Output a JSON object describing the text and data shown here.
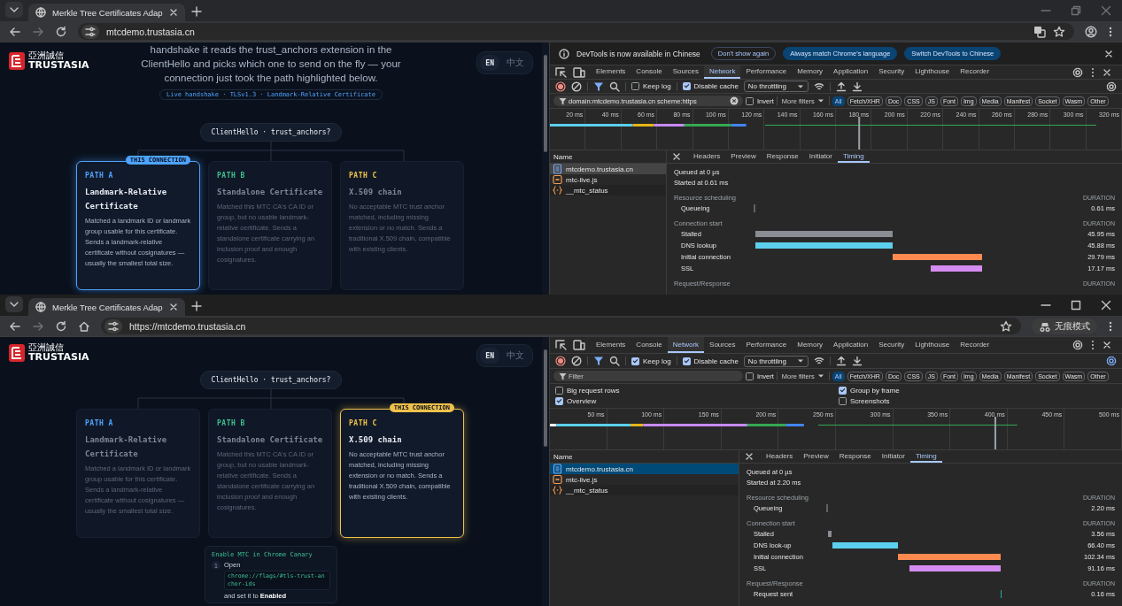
{
  "windows": [
    {
      "active": false,
      "tab_title": "Merkle Tree Certificates Adap",
      "address": "mtcdemo.trustasia.cn",
      "home_button": false,
      "translate_button": true,
      "profile_button": true,
      "page": {
        "logo": {
          "cn": "亞洲誠信",
          "en": "TRUSTASIA"
        },
        "languages": [
          {
            "label": "EN",
            "selected": true
          },
          {
            "label": "中文",
            "selected": false
          }
        ],
        "intro": "handshake it reads the trust_anchors extension in the ClientHello and picks which one to send on the fly — your connection just took the path highlighted below.",
        "handshake_badge": "Live handshake · TLSv1.3 · Landmark-Relative Certificate",
        "root": "ClientHello · trust_anchors?",
        "selected_badge": "THIS CONNECTION",
        "paths": [
          {
            "label": "PATH A",
            "title": "Landmark-Relative Certificate",
            "text": "Matched a landmark ID or landmark group usable for this certificate. Sends a landmark-relative certificate without cosignatures — usually the smallest total size.",
            "color": "#4ea3ff",
            "selected": true
          },
          {
            "label": "PATH B",
            "title": "Standalone Certificate",
            "text": "Matched this MTC CA's CA ID or group, but no usable landmark-relative certificate. Sends a standalone certificate carrying an inclusion proof and enough cosignatures.",
            "color": "#3fbf8f",
            "selected": false
          },
          {
            "label": "PATH C",
            "title": "X.509 chain",
            "text": "No acceptable MTC trust anchor matched, including missing extension or no match. Sends a traditional X.509 chain, compatible with existing clients.",
            "color": "#f0c24b",
            "selected": false
          }
        ]
      },
      "devtools": {
        "infobar": {
          "text": "DevTools is now available in Chinese",
          "buttons": [
            {
              "label": "Don't show again",
              "kind": "outline"
            },
            {
              "label": "Always match Chrome's language",
              "kind": "filled"
            },
            {
              "label": "Switch DevTools to Chinese",
              "kind": "filled"
            }
          ]
        },
        "panels": [
          {
            "label": "Elements",
            "selected": false
          },
          {
            "label": "Console",
            "selected": false
          },
          {
            "label": "Sources",
            "selected": false
          },
          {
            "label": "Network",
            "selected": true
          },
          {
            "label": "Performance",
            "selected": false
          },
          {
            "label": "Memory",
            "selected": false
          },
          {
            "label": "Application",
            "selected": false
          },
          {
            "label": "Security",
            "selected": false
          },
          {
            "label": "Lighthouse",
            "selected": false
          },
          {
            "label": "Recorder",
            "selected": false
          }
        ],
        "keep_log": {
          "label": "Keep log",
          "checked": false
        },
        "disable_cache": {
          "label": "Disable cache",
          "checked": true
        },
        "throttling": "No throttling",
        "filter": {
          "value": "domain:mtcdemo.trustasia.cn scheme:https"
        },
        "invert": {
          "label": "Invert",
          "checked": false
        },
        "more_filters": "More filters",
        "types": [
          {
            "label": "All",
            "selected": true
          },
          {
            "label": "Fetch/XHR",
            "selected": false
          },
          {
            "label": "Doc",
            "selected": false
          },
          {
            "label": "CSS",
            "selected": false
          },
          {
            "label": "JS",
            "selected": false
          },
          {
            "label": "Font",
            "selected": false
          },
          {
            "label": "Img",
            "selected": false
          },
          {
            "label": "Media",
            "selected": false
          },
          {
            "label": "Manifest",
            "selected": false
          },
          {
            "label": "Socket",
            "selected": false
          },
          {
            "label": "Wasm",
            "selected": false
          },
          {
            "label": "Other",
            "selected": false
          }
        ],
        "ticks": [
          "20 ms",
          "40 ms",
          "60 ms",
          "80 ms",
          "100 ms",
          "120 ms",
          "140 ms",
          "160 ms",
          "180 ms",
          "200 ms",
          "220 ms",
          "240 ms",
          "260 ms",
          "280 ms",
          "300 ms",
          "320 ms"
        ],
        "name_header": "Name",
        "requests": [
          {
            "name": "mtcdemo.trustasia.cn",
            "kind": "document",
            "selected": true
          },
          {
            "name": "mtc-live.js",
            "kind": "script",
            "selected": false
          },
          {
            "name": "__mtc_status",
            "kind": "fetch",
            "selected": false
          }
        ],
        "detail_tabs": [
          {
            "label": "Headers",
            "selected": false
          },
          {
            "label": "Preview",
            "selected": false
          },
          {
            "label": "Response",
            "selected": false
          },
          {
            "label": "Initiator",
            "selected": false
          },
          {
            "label": "Timing",
            "selected": true
          }
        ],
        "queued": "Queued at 0 µs",
        "started": "Started at 0.61 ms",
        "sections": [
          {
            "title": "Resource scheduling",
            "column": "DURATION",
            "rows": [
              {
                "label": "Queueing",
                "kind": "queueing",
                "duration": "0.61 ms"
              }
            ]
          },
          {
            "title": "Connection start",
            "column": "DURATION",
            "rows": [
              {
                "label": "Stalled",
                "kind": "stalled",
                "duration": "45.95 ms"
              },
              {
                "label": "DNS lookup",
                "kind": "dns",
                "duration": "45.88 ms"
              },
              {
                "label": "Initial connection",
                "kind": "initial",
                "duration": "29.79 ms"
              },
              {
                "label": "SSL",
                "kind": "ssl",
                "duration": "17.17 ms"
              }
            ]
          },
          {
            "title": "Request/Response",
            "column": "DURATION"
          }
        ]
      }
    },
    {
      "active": true,
      "tab_title": "Merkle Tree Certificates Adap",
      "address": "https://mtcdemo.trustasia.cn",
      "home_button": true,
      "translate_button": false,
      "profile_button": false,
      "incognito_label": "无痕模式",
      "page": {
        "logo": {
          "cn": "亞洲誠信",
          "en": "TRUSTASIA"
        },
        "languages": [
          {
            "label": "EN",
            "selected": true
          },
          {
            "label": "中文",
            "selected": false
          }
        ],
        "root": "ClientHello · trust_anchors?",
        "selected_badge": "THIS CONNECTION",
        "paths": [
          {
            "label": "PATH A",
            "title": "Landmark-Relative Certificate",
            "text": "Matched a landmark ID or landmark group usable for this certificate. Sends a landmark-relative certificate without cosignatures — usually the smallest total size.",
            "color": "#4ea3ff",
            "selected": false
          },
          {
            "label": "PATH B",
            "title": "Standalone Certificate",
            "text": "Matched this MTC CA's CA ID or group, but no usable landmark-relative certificate. Sends a standalone certificate carrying an inclusion proof and enough cosignatures.",
            "color": "#3fbf8f",
            "selected": false
          },
          {
            "label": "PATH C",
            "title": "X.509 chain",
            "text": "No acceptable MTC trust anchor matched, including missing extension or no match. Sends a traditional X.509 chain, compatible with existing clients.",
            "color": "#f0c24b",
            "selected": true
          }
        ],
        "enable": {
          "title": "Enable MTC in Chrome Canary",
          "steps": [
            {
              "number": "1",
              "text": "Open",
              "code": "chrome://flags/#tls-trust-anchor-ids",
              "after": "and set it to **Enabled**"
            }
          ]
        }
      },
      "devtools": {
        "panels": [
          {
            "label": "Elements",
            "selected": false
          },
          {
            "label": "Console",
            "selected": false
          },
          {
            "label": "Network",
            "selected": true
          },
          {
            "label": "Sources",
            "selected": false
          },
          {
            "label": "Performance",
            "selected": false
          },
          {
            "label": "Memory",
            "selected": false
          },
          {
            "label": "Application",
            "selected": false
          },
          {
            "label": "Security",
            "selected": false
          },
          {
            "label": "Lighthouse",
            "selected": false
          },
          {
            "label": "Recorder",
            "selected": false
          }
        ],
        "keep_log": {
          "label": "Keep log",
          "checked": true
        },
        "disable_cache": {
          "label": "Disable cache",
          "checked": true
        },
        "throttling": "No throttling",
        "filter": {
          "placeholder": "Filter"
        },
        "invert": {
          "label": "Invert",
          "checked": false
        },
        "more_filters": "More filters",
        "types": [
          {
            "label": "All",
            "selected": true
          },
          {
            "label": "Fetch/XHR",
            "selected": false
          },
          {
            "label": "Doc",
            "selected": false
          },
          {
            "label": "CSS",
            "selected": false
          },
          {
            "label": "JS",
            "selected": false
          },
          {
            "label": "Font",
            "selected": false
          },
          {
            "label": "Img",
            "selected": false
          },
          {
            "label": "Media",
            "selected": false
          },
          {
            "label": "Manifest",
            "selected": false
          },
          {
            "label": "Socket",
            "selected": false
          },
          {
            "label": "Wasm",
            "selected": false
          },
          {
            "label": "Other",
            "selected": false
          }
        ],
        "options": [
          {
            "label": "Big request rows",
            "checked": false
          },
          {
            "label": "Group by frame",
            "checked": true
          },
          {
            "label": "Overview",
            "checked": true
          },
          {
            "label": "Screenshots",
            "checked": false
          }
        ],
        "ticks": [
          "50 ms",
          "100 ms",
          "150 ms",
          "200 ms",
          "250 ms",
          "300 ms",
          "350 ms",
          "400 ms",
          "450 ms",
          "500 ms"
        ],
        "name_header": "Name",
        "requests": [
          {
            "name": "mtcdemo.trustasia.cn",
            "kind": "document",
            "selected": true
          },
          {
            "name": "mtc-live.js",
            "kind": "script",
            "selected": false
          },
          {
            "name": "__mtc_status",
            "kind": "fetch",
            "selected": false
          }
        ],
        "detail_tabs": [
          {
            "label": "Headers",
            "selected": false
          },
          {
            "label": "Preview",
            "selected": false
          },
          {
            "label": "Response",
            "selected": false
          },
          {
            "label": "Initiator",
            "selected": false
          },
          {
            "label": "Timing",
            "selected": true
          }
        ],
        "queued": "Queued at 0 µs",
        "started": "Started at 2.20 ms",
        "sections": [
          {
            "title": "Resource scheduling",
            "column": "DURATION",
            "rows": [
              {
                "label": "Queueing",
                "kind": "queueing",
                "duration": "2.20 ms"
              }
            ]
          },
          {
            "title": "Connection start",
            "column": "DURATION",
            "rows": [
              {
                "label": "Stalled",
                "kind": "stalled",
                "duration": "3.56 ms"
              },
              {
                "label": "DNS look-up",
                "kind": "dns",
                "duration": "66.40 ms"
              },
              {
                "label": "Initial connection",
                "kind": "initial",
                "duration": "102.34 ms"
              },
              {
                "label": "SSL",
                "kind": "ssl",
                "duration": "91.16 ms"
              }
            ]
          },
          {
            "title": "Request/Response",
            "column": "DURATION",
            "rows": [
              {
                "label": "Request sent",
                "kind": "request",
                "duration": "0.16 ms"
              }
            ]
          }
        ]
      }
    }
  ]
}
